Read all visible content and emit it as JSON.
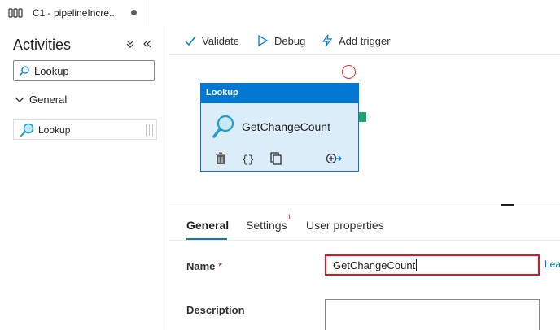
{
  "tab": {
    "title": "C1 - pipelineIncre...",
    "icon": "pipeline-icon"
  },
  "left_panel": {
    "title": "Activities",
    "collapse_icon": "collapse-all-icon",
    "hide_icon": "hide-panel-icon",
    "search": {
      "value": "Lookup",
      "icon": "search-icon"
    },
    "group": {
      "label": "General",
      "expanded": true
    },
    "activity": {
      "label": "Lookup",
      "icon": "lookup-icon"
    }
  },
  "toolbar": {
    "validate_label": "Validate",
    "debug_label": "Debug",
    "add_trigger_label": "Add trigger"
  },
  "canvas": {
    "node": {
      "type_label": "Lookup",
      "name": "GetChangeCount",
      "actions": [
        "delete-icon",
        "code-icon",
        "copy-icon",
        "add-output-icon"
      ]
    }
  },
  "properties": {
    "tabs": [
      {
        "label": "General",
        "active": true
      },
      {
        "label": "Settings",
        "badge": "1"
      },
      {
        "label": "User properties"
      }
    ],
    "name_label": "Name",
    "required_mark": "*",
    "name_value": "GetChangeCount",
    "learn_more_text": "Lea",
    "description_label": "Description",
    "description_value": ""
  },
  "colors": {
    "accent": "#0078d4",
    "node_fill": "#dcedfa",
    "success_handle": "#21a366",
    "error": "#e81123"
  }
}
